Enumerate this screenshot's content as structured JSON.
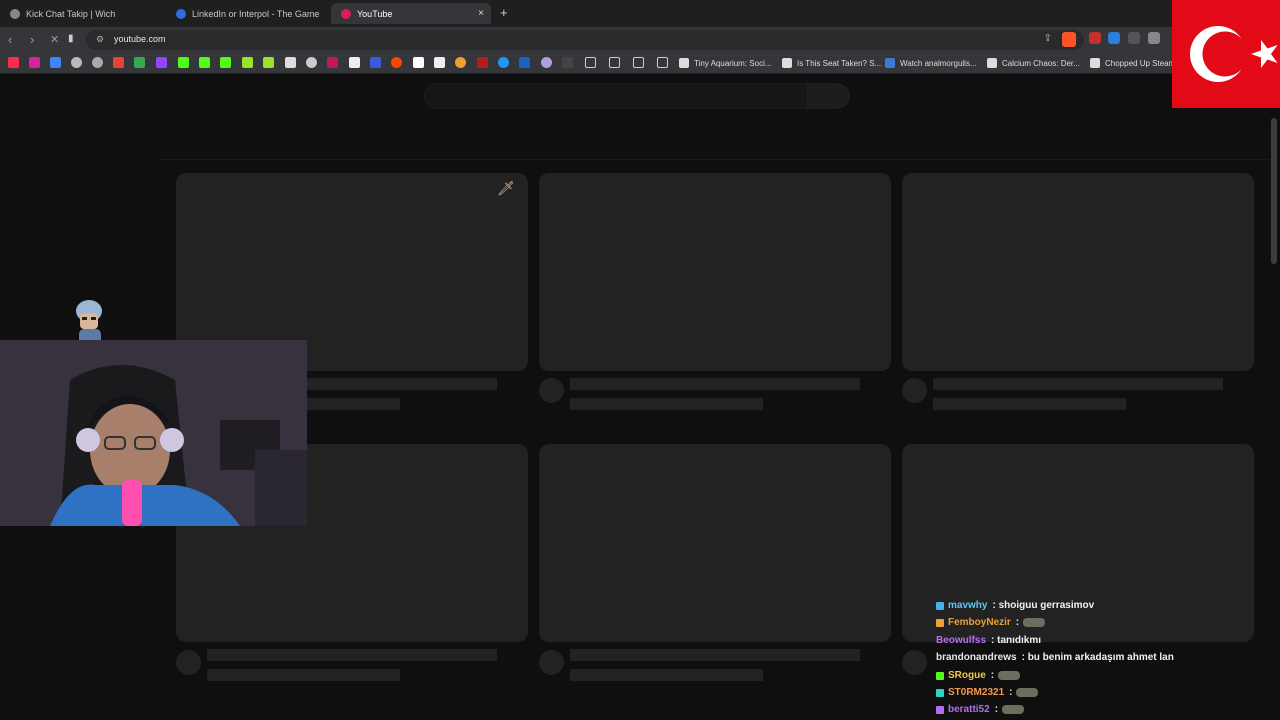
{
  "browser": {
    "tabs": [
      {
        "title": "Kick Chat Takip | Wich",
        "active": false
      },
      {
        "title": "LinkedIn or Interpol - The Game",
        "active": false
      },
      {
        "title": "YouTube",
        "active": true
      }
    ],
    "new_tab_label": "+",
    "close_tab_label": "×",
    "url": "youtube.com",
    "bookmarks": [
      {
        "title": "Tiny Aquarium: Soci..."
      },
      {
        "title": "Is This Seat Taken? S..."
      },
      {
        "title": "Watch analmorgulis..."
      },
      {
        "title": "Calcium Chaos: Der..."
      },
      {
        "title": "Chopped Up Steam"
      }
    ]
  },
  "overlay": {
    "flag": "turkey",
    "chat": [
      {
        "user": "mavwhy",
        "message": "shoiguu gerrasimov",
        "color": "#5ac8f5",
        "badge": "#3fb5e8"
      },
      {
        "user": "FemboyNezir",
        "message": "",
        "emote": true,
        "color": "#e8a23b",
        "badge": "#e8a23b"
      },
      {
        "user": "Beowulfss",
        "message": "tanıdıkmı",
        "color": "#b46cf0",
        "badge": null
      },
      {
        "user": "brandonandrews",
        "message": "bu benim arkadaşım ahmet lan",
        "color": "#e8e8e8",
        "badge": null
      },
      {
        "user": "SRogue",
        "message": "",
        "emote": true,
        "color": "#f2c94c",
        "badge": "#53fc18"
      },
      {
        "user": "ST0RM2321",
        "message": "",
        "emote": true,
        "color": "#f2994a",
        "badge": "#2dd4bf"
      },
      {
        "user": "beratti52",
        "message": "",
        "emote": true,
        "color": "#b46cf0",
        "badge": "#b46cf0"
      }
    ]
  }
}
